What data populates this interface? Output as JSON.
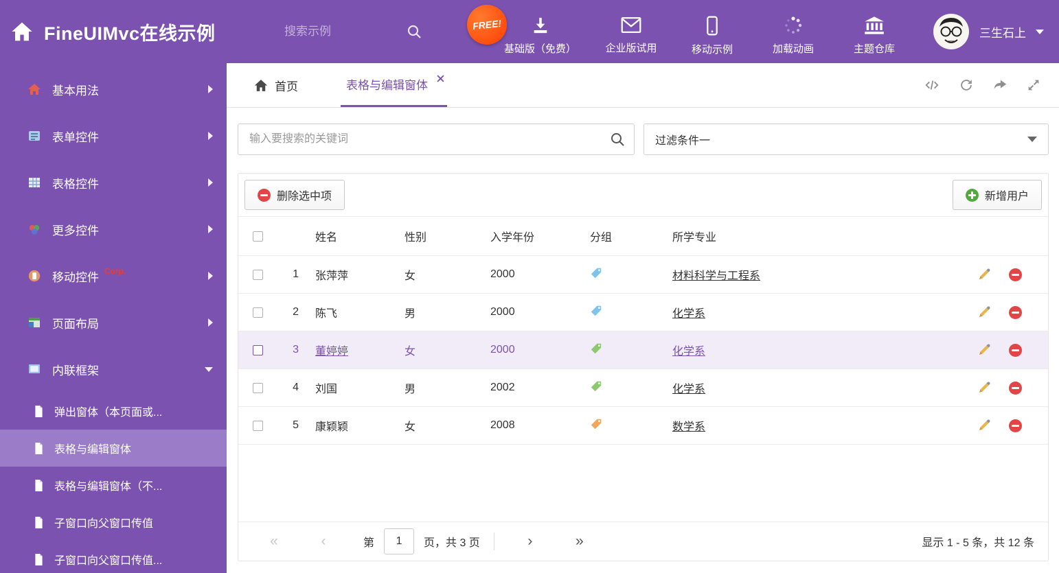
{
  "colors": {
    "accent_purple": "#7b52af",
    "sidebar_selected": "#9a7cc9",
    "free_badge_orange": "#ff3c00",
    "delete_red": "#e24545",
    "add_green": "#53a93f",
    "selected_row_bg": "#f2ecf9"
  },
  "header": {
    "logo_title": "FineUIMvc在线示例",
    "search_placeholder": "搜索示例",
    "free_badge": "FREE!",
    "nav_items": [
      {
        "label": "基础版（免费）",
        "icon": "download-icon"
      },
      {
        "label": "企业版试用",
        "icon": "envelope-icon"
      },
      {
        "label": "移动示例",
        "icon": "mobile-icon"
      },
      {
        "label": "加载动画",
        "icon": "spinner-icon"
      },
      {
        "label": "主题仓库",
        "icon": "bank-icon"
      }
    ],
    "username": "三生石上"
  },
  "sidebar": {
    "items": [
      {
        "label": "基本用法"
      },
      {
        "label": "表单控件"
      },
      {
        "label": "表格控件"
      },
      {
        "label": "更多控件"
      },
      {
        "label": "移动控件",
        "badge": "Corp."
      },
      {
        "label": "页面布局"
      },
      {
        "label": "内联框架",
        "expanded": true
      }
    ],
    "subitems": [
      {
        "label": "弹出窗体（本页面或...",
        "selected": false
      },
      {
        "label": "表格与编辑窗体",
        "selected": true
      },
      {
        "label": "表格与编辑窗体（不...",
        "selected": false
      },
      {
        "label": "子窗口向父窗口传值",
        "selected": false
      },
      {
        "label": "子窗口向父窗口传值...",
        "selected": false
      }
    ]
  },
  "tabbar": {
    "home_tab": "首页",
    "active_tab": "表格与编辑窗体"
  },
  "filters": {
    "search_placeholder": "输入要搜索的关键词",
    "filter_value": "过滤条件一"
  },
  "toolbar": {
    "delete_label": "删除选中项",
    "add_label": "新增用户"
  },
  "table": {
    "headers": {
      "name": "姓名",
      "gender": "性别",
      "year": "入学年份",
      "group": "分组",
      "major": "所学专业"
    },
    "rows": [
      {
        "num": "1",
        "name": "张萍萍",
        "gender": "女",
        "year": "2000",
        "tag_color": "#7cc4ea",
        "major": "材料科学与工程系",
        "selected": false
      },
      {
        "num": "2",
        "name": "陈飞",
        "gender": "男",
        "year": "2000",
        "tag_color": "#7cc4ea",
        "major": "化学系",
        "selected": false
      },
      {
        "num": "3",
        "name": "董婷婷",
        "gender": "女",
        "year": "2000",
        "tag_color": "#8ec86e",
        "major": "化学系",
        "selected": true
      },
      {
        "num": "4",
        "name": "刘国",
        "gender": "男",
        "year": "2002",
        "tag_color": "#8ec86e",
        "major": "化学系",
        "selected": false
      },
      {
        "num": "5",
        "name": "康颖颖",
        "gender": "女",
        "year": "2008",
        "tag_color": "#f2a65a",
        "major": "数学系",
        "selected": false
      }
    ]
  },
  "pagination": {
    "icons": {
      "first": "«",
      "prev": "‹",
      "next": "›",
      "last": "»"
    },
    "page_prefix": "第",
    "current_page": "1",
    "page_suffix": "页，共 3 页",
    "summary": "显示 1 - 5 条，共 12 条"
  }
}
